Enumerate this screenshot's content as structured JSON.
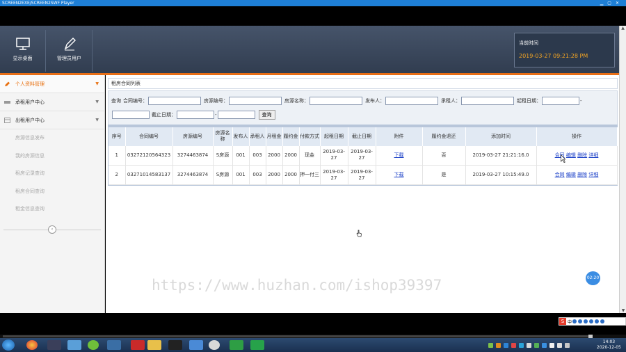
{
  "window": {
    "title": "SCREEN2EXE/SCREEN2SWF Player"
  },
  "header": {
    "buttons": [
      {
        "label": "显示桌面",
        "icon": "monitor-icon"
      },
      {
        "label": "管理员用户",
        "icon": "pencil-icon"
      }
    ],
    "time_label": "当前时间",
    "time_value": "2019-03-27 09:21:28 PM"
  },
  "sidebar": {
    "groups": [
      {
        "label": "个人资料管理",
        "icon": "pencil-icon",
        "active": true
      },
      {
        "label": "承租用户中心",
        "icon": "user-group-icon",
        "active": false
      },
      {
        "label": "出租用户中心",
        "icon": "building-icon",
        "active": false
      }
    ],
    "sub_items": [
      "房源信息发布",
      "我的房源信息",
      "租房记录查询",
      "租房合同查询",
      "租金信息查询"
    ],
    "collapse_glyph": "‹"
  },
  "panel": {
    "title": "租房合同列表"
  },
  "search": {
    "prefix": "查询",
    "fields": [
      {
        "label": "合同编号：",
        "value": ""
      },
      {
        "label": "房源编号：",
        "value": ""
      },
      {
        "label": "房源名称：",
        "value": ""
      },
      {
        "label": "发布人：",
        "value": ""
      },
      {
        "label": "承租人：",
        "value": ""
      },
      {
        "label": "起租日期：",
        "value": ""
      }
    ],
    "range_sep": "-",
    "end_label": "截止日期：",
    "button": "查询"
  },
  "table": {
    "headers": [
      "序号",
      "合同编号",
      "房源编号",
      "房源名称",
      "发布人",
      "承租人",
      "月租金",
      "履约金",
      "付款方式",
      "起租日期",
      "截止日期",
      "附件",
      "履约金退还",
      "添加时间",
      "操作"
    ],
    "rows": [
      {
        "no": "1",
        "contract": "03272120564323",
        "house": "3274463874",
        "name": "S房源",
        "publisher": "001",
        "tenant": "003",
        "rent": "2000",
        "deposit": "2000",
        "pay": "现金",
        "start": "2019-03-27",
        "end": "2019-03-27",
        "attach": "下载",
        "refund": "否",
        "added": "2019-03-27 21:21:16.0"
      },
      {
        "no": "2",
        "contract": "03271014583137",
        "house": "3274463874",
        "name": "S房源",
        "publisher": "001",
        "tenant": "003",
        "rent": "2000",
        "deposit": "2000",
        "pay": "押一付三",
        "start": "2019-03-27",
        "end": "2019-03-27",
        "attach": "下载",
        "refund": "是",
        "added": "2019-03-27 10:15:49.0"
      }
    ],
    "actions": [
      "合同",
      "编辑",
      "删除",
      "详细"
    ]
  },
  "recording": {
    "timer": "02:20"
  },
  "watermark": "https://www.huzhan.com/ishop39397",
  "ime": {
    "logo": "S",
    "mode": "中"
  },
  "player": {
    "progress": 0.995
  },
  "taskbar": {
    "time": "14:03",
    "date": "2020-12-05"
  }
}
